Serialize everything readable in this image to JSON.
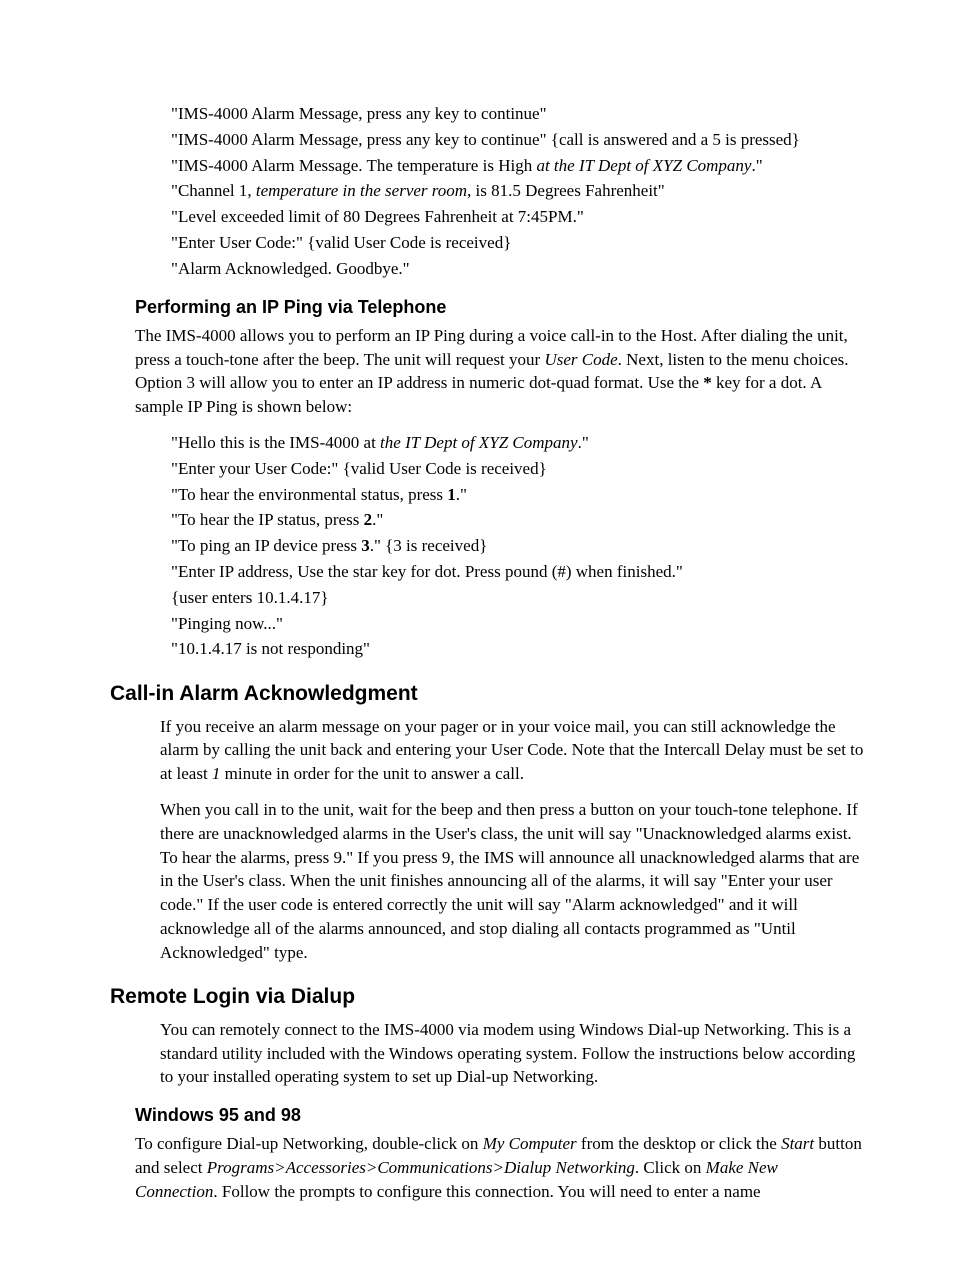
{
  "alarm_dialogue": {
    "l1_q": "\"IMS-4000 Alarm Message, press any key to continue\"",
    "l2_q": "\"IMS-4000 Alarm Message, press any key to continue\"",
    "l2_note": "   {call is answered and a 5 is pressed}",
    "l3_a": "\"IMS-4000 Alarm Message. The temperature is High ",
    "l3_i": "at the IT Dept of XYZ Company",
    "l3_b": ".\"",
    "l4_a": "\"Channel 1, ",
    "l4_i": "temperature in the server room",
    "l4_b": ", is 81.5 Degrees Fahrenheit\"",
    "l5": "\"Level exceeded limit of 80 Degrees Fahrenheit at 7:45PM.\"",
    "l6_q": "\"Enter User Code:\"",
    "l6_note": "   {valid User Code is received}",
    "l7": "\"Alarm Acknowledged. Goodbye.\""
  },
  "ip_ping_heading": "Performing an IP Ping via Telephone",
  "ip_ping_para": {
    "a": "The IMS-4000 allows you to perform an IP Ping during a voice call-in to the Host.  After dialing the unit, press a touch-tone after the beep.  The unit will request your ",
    "i1": "User Code",
    "b": ".  Next, listen to the menu choices.  Option 3 will allow you to enter an IP address in numeric dot-quad format.  Use the ",
    "s1": "*",
    "c": " key for a dot.  A sample IP Ping is shown below:"
  },
  "ip_ping_dialogue": {
    "l1_a": "\"Hello this is the IMS-4000 at ",
    "l1_i": "the IT Dept of XYZ Company",
    "l1_b": ".\"",
    "l2_q": "\"Enter your User Code:\"",
    "l2_note": "   {valid User Code is received}",
    "l3_a": "\"To hear the environmental status, press ",
    "l3_s": "1",
    "l3_b": ".\"",
    "l4_a": "\"To hear the IP status, press ",
    "l4_s": "2",
    "l4_b": ".\"",
    "l5_a": "\"To ping an IP device press ",
    "l5_s": "3",
    "l5_b": ".\"",
    "l5_note": "      {3 is received}",
    "l6": "\"Enter IP address, Use the star key for dot. Press pound (#) when finished.\"",
    "l7": "{user enters  10.1.4.17}",
    "l8": "\"Pinging now...\"",
    "l9": "\"10.1.4.17 is not responding\""
  },
  "callin_heading": "Call-in Alarm Acknowledgment",
  "callin_para1": {
    "a": "If you receive an alarm message on your pager or in your voice mail, you can still acknowledge the alarm by calling the unit back and entering your User Code. Note that the Intercall Delay must be set to at least ",
    "i1": "1",
    "b": " minute in order for the unit to answer a call."
  },
  "callin_para2": "When you call in to the unit, wait for the beep and then press a button on your touch-tone telephone. If there are unacknowledged alarms in the User's class, the unit will say \"Unacknowledged alarms exist.  To hear the alarms, press 9.\"  If you press 9, the IMS will announce all unacknowledged alarms that are in the User's class. When the unit finishes announcing all of the alarms, it will say \"Enter your user code.\"  If the user code is entered correctly the unit will say \"Alarm acknowledged\" and it will acknowledge all of the alarms announced, and stop dialing all contacts programmed as \"Until Acknowledged\" type.",
  "remote_heading": "Remote Login via Dialup",
  "remote_para": "You can remotely connect to the IMS-4000 via modem using Windows Dial-up Networking.  This is a standard utility included with the Windows operating system. Follow the instructions below according to your installed operating system to set up Dial-up Networking.",
  "win_heading": "Windows 95 and 98",
  "win_para": {
    "a": "To configure Dial-up Networking, double-click on ",
    "i1": "My Computer",
    "b": " from the desktop or click the ",
    "i2": "Start",
    "c": " button and select ",
    "i3": "Programs>Accessories>Communications>Dialup Networking",
    "d": ". Click on ",
    "i4": "Make New Connection",
    "e": ". Follow the prompts to configure this connection. You will need to enter a name"
  }
}
